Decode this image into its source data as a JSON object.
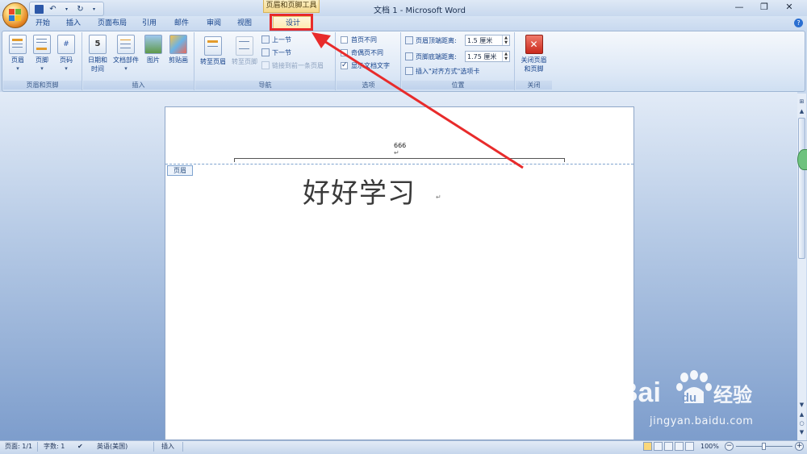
{
  "window": {
    "title": "文档 1 - Microsoft Word",
    "contextual_tools_header": "页眉和页脚工具",
    "controls": {
      "minimize": "—",
      "restore": "❐",
      "close": "✕"
    }
  },
  "quick_access": {
    "save_icon": "save-icon",
    "undo_icon": "undo-icon",
    "redo_icon": "redo-icon"
  },
  "tabs": [
    "开始",
    "插入",
    "页面布局",
    "引用",
    "邮件",
    "审阅",
    "视图"
  ],
  "active_tab": "设计",
  "ribbon": {
    "groups": {
      "header_footer": {
        "label": "页眉和页脚",
        "buttons": [
          "页眉",
          "页脚",
          "页码"
        ]
      },
      "insert": {
        "label": "插入",
        "date_time_line1": "日期和",
        "date_time_line2": "时间",
        "doc_parts": "文档部件",
        "picture": "图片",
        "clip_art": "剪贴画"
      },
      "navigation": {
        "label": "导航",
        "goto_header": "转至页眉",
        "goto_footer": "转至页脚",
        "previous_section": "上一节",
        "next_section": "下一节",
        "link_to_previous": "链接到前一条页眉"
      },
      "options": {
        "label": "选项",
        "different_first_page": "首页不同",
        "different_odd_even": "奇偶页不同",
        "show_document_text": "显示文档文字",
        "show_document_text_checked": true
      },
      "position": {
        "label": "位置",
        "header_from_top_label": "页眉顶端距离:",
        "header_from_top_value": "1.5 厘米",
        "footer_from_bottom_label": "页脚底端距离:",
        "footer_from_bottom_value": "1.75 厘米",
        "insert_alignment_tab": "插入\"对齐方式\"选项卡"
      },
      "close": {
        "label": "关闭",
        "close_header_footer_line1": "关闭页眉",
        "close_header_footer_line2": "和页脚"
      }
    }
  },
  "document": {
    "header_text": "666",
    "header_tag": "页眉",
    "body_text": "好好学习",
    "paragraph_mark": "↵"
  },
  "statusbar": {
    "page": "页面: 1/1",
    "words": "字数: 1",
    "language": "英语(美国)",
    "mode": "插入",
    "zoom": "100%",
    "zoom_minus": "−",
    "zoom_plus": "+"
  },
  "watermark": {
    "brand_prefix": "Bai",
    "brand_suffix": "经验",
    "url": "jingyan.baidu.com"
  },
  "colors": {
    "highlight_red": "#e82b2b",
    "ribbon_text": "#15428b"
  }
}
